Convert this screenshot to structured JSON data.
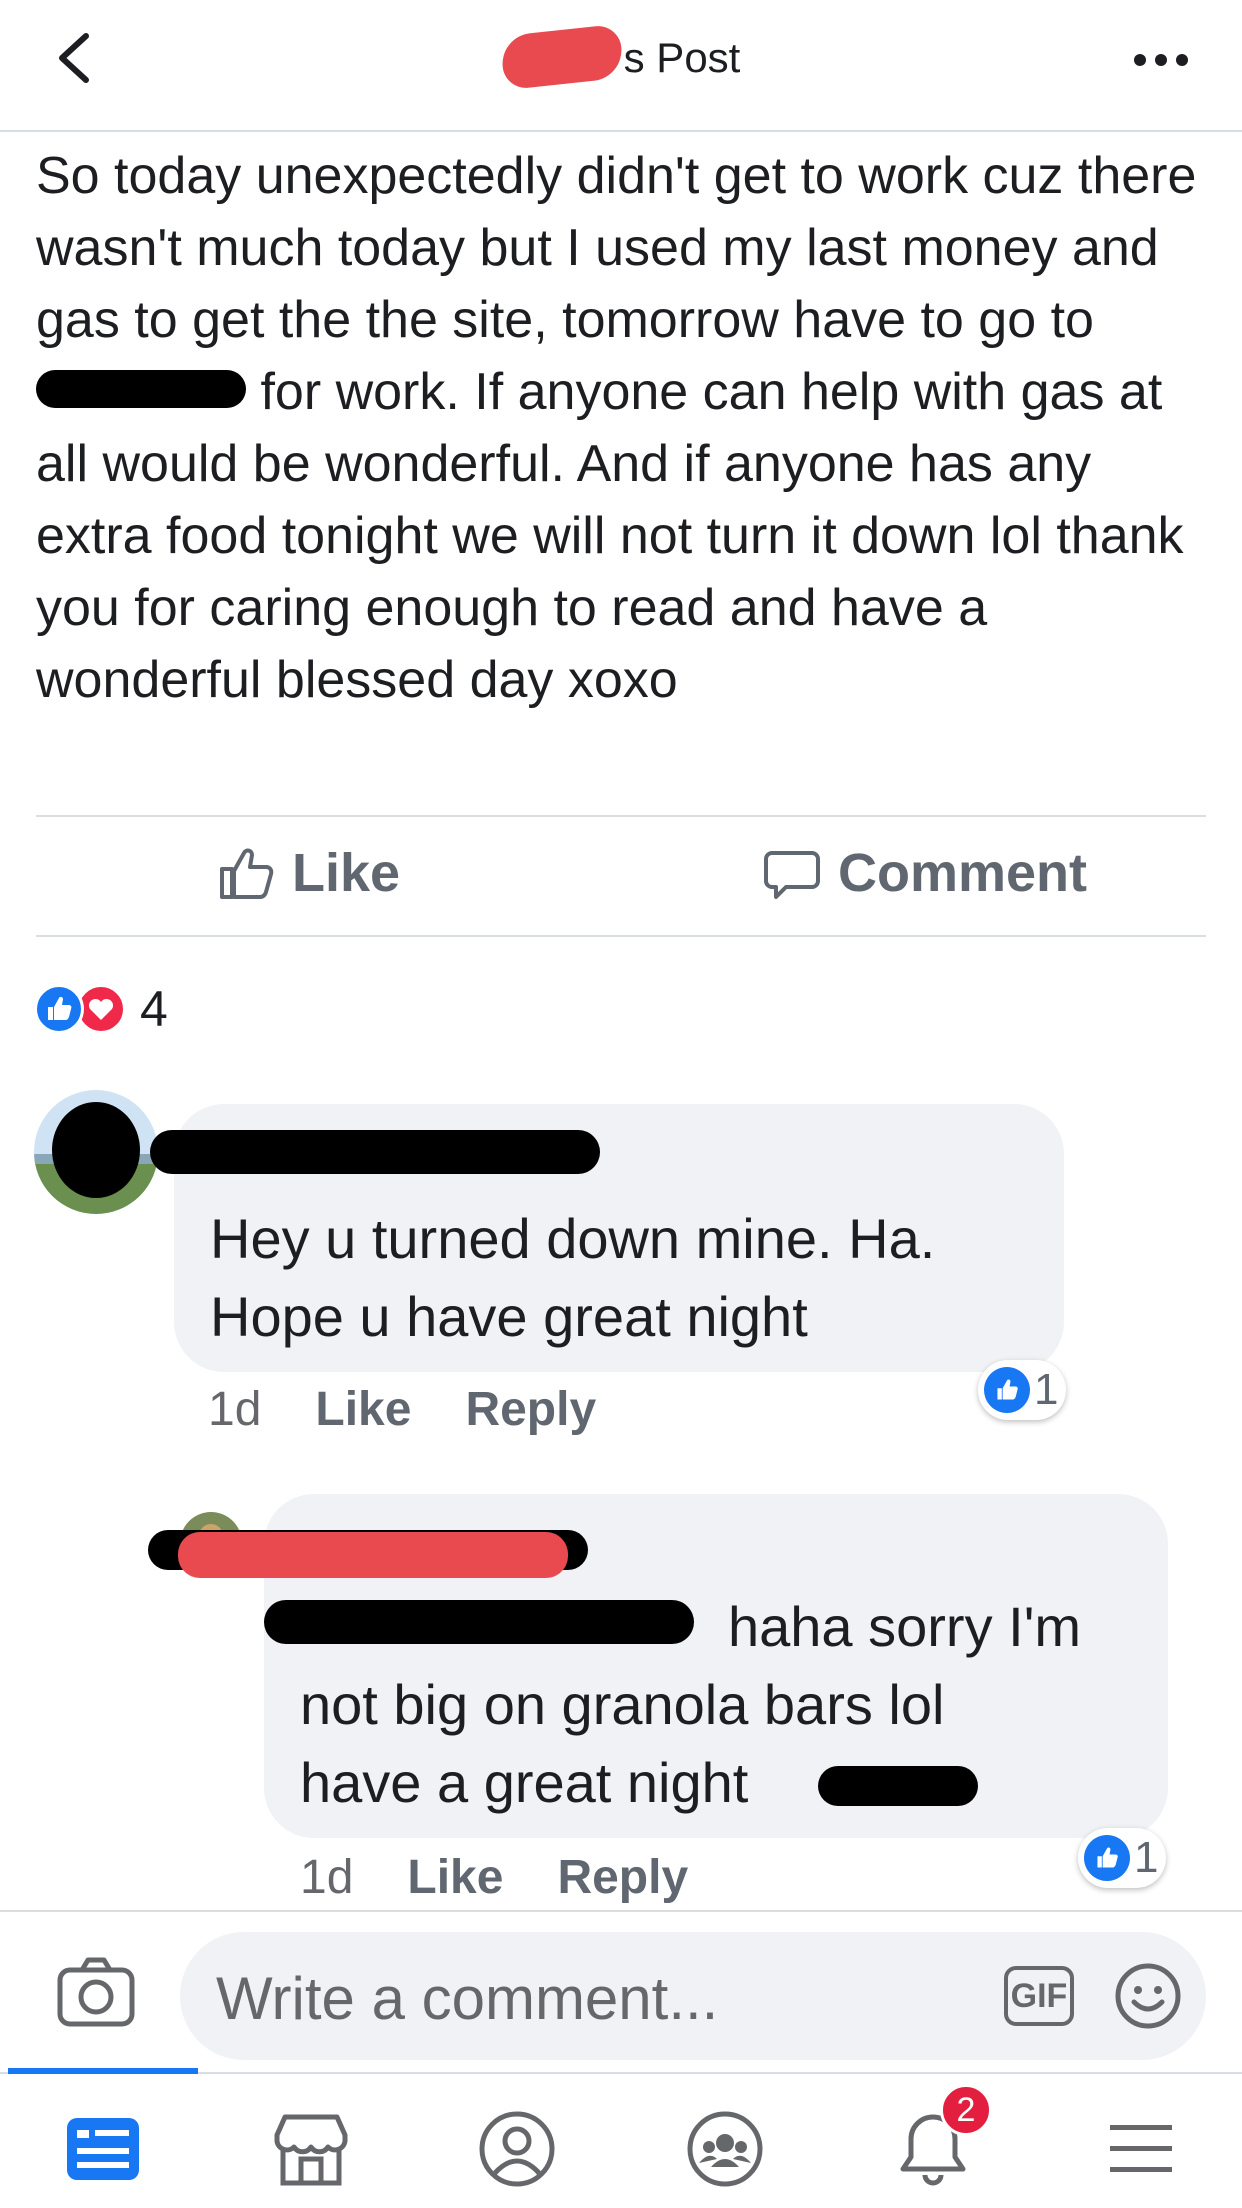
{
  "header": {
    "title_suffix": "s Post"
  },
  "post": {
    "text_before_redaction": "So today unexpectedly didn't get to work cuz there wasn't much today but I used my last money and gas to get the the site, tomorrow have to go to",
    "text_after_redaction": "for work. If anyone can help with gas at all would be wonderful. And if anyone has any extra food tonight we will not turn it down lol thank you for caring enough to read and have a wonderful blessed day xoxo"
  },
  "actions": {
    "like_label": "Like",
    "comment_label": "Comment"
  },
  "reactions": {
    "count": "4"
  },
  "comments": [
    {
      "text": "Hey u turned down mine. Ha. Hope u have great night",
      "time": "1d",
      "like_label": "Like",
      "reply_label": "Reply",
      "like_count": "1"
    },
    {
      "text_line1": "haha sorry I'm",
      "text_line2": "not big on granola bars lol",
      "text_line3": "have a great night",
      "time": "1d",
      "like_label": "Like",
      "reply_label": "Reply",
      "like_count": "1"
    }
  ],
  "composer": {
    "placeholder": "Write a comment...",
    "gif_label": "GIF"
  },
  "nav": {
    "notifications_badge": "2"
  },
  "colors": {
    "accent": "#1877f2",
    "love": "#f0284a",
    "badge": "#e41e3f",
    "bubble": "#f0f2f5"
  }
}
